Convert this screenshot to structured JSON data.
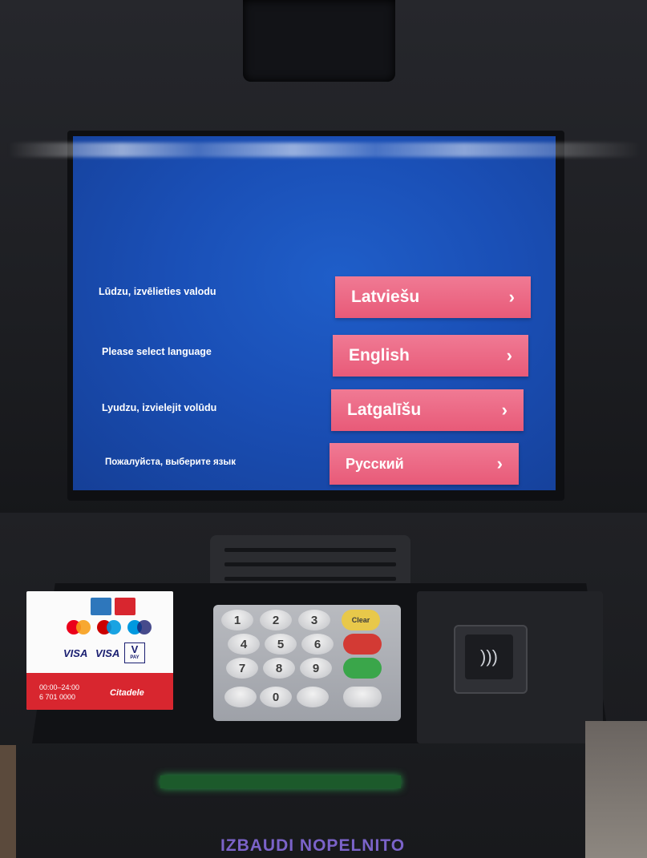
{
  "screen": {
    "languages": [
      {
        "prompt": "Lūdzu, izvēlieties valodu",
        "button": "Latviešu"
      },
      {
        "prompt": "Please select language",
        "button": "English"
      },
      {
        "prompt": "Lyudzu, izvielejit volūdu",
        "button": "Latgalīšu"
      },
      {
        "prompt": "Пожалуйста, выберите язык",
        "button": "Русский"
      }
    ],
    "chevron": "›",
    "accent_color": "#e85a78",
    "background_color": "#1a4fb6"
  },
  "sticker": {
    "hours": "00:00–24:00",
    "phone": "6 701 0000",
    "brand": "Citadele",
    "card_logos": [
      "amex-logo",
      "ec-logo",
      "mastercard-logo",
      "maestro-logo",
      "visa-logo",
      "visa-electron-logo",
      "vpay-logo"
    ],
    "visa": "VISA",
    "visa_electron": "VISA",
    "vpay": "V",
    "vpay_sub": "PAY"
  },
  "keypad": {
    "keys": [
      "1",
      "2",
      "3",
      "4",
      "5",
      "6",
      "7",
      "8",
      "9",
      "0"
    ],
    "clear": "Clear"
  },
  "banner": "IZBAUDI NOPELNITO"
}
